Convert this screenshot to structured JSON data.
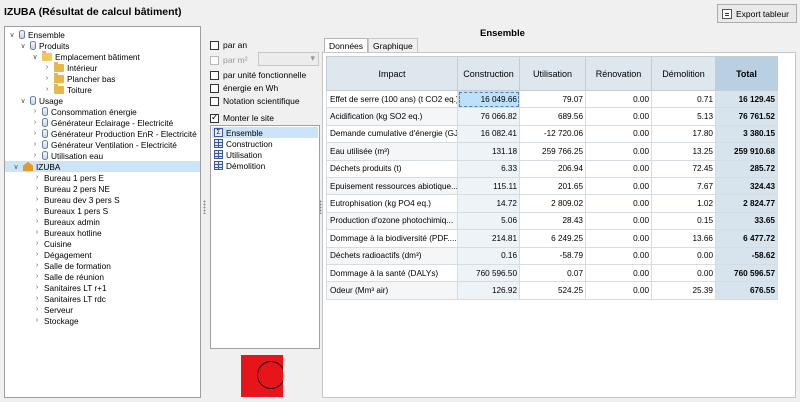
{
  "window": {
    "title": "IZUBA (Résultat de calcul bâtiment)",
    "export_label": "Export tableur"
  },
  "tree": {
    "items": [
      {
        "label": "Ensemble",
        "icon": "database-icon",
        "expander": "expanded"
      },
      {
        "label": "Produits",
        "icon": "database-icon",
        "expander": "expanded"
      },
      {
        "label": "Emplacement bâtiment",
        "icon": "folder-open-icon",
        "expander": "expanded"
      },
      {
        "label": "Intérieur",
        "icon": "folder-icon",
        "expander": "collapsed"
      },
      {
        "label": "Plancher bas",
        "icon": "folder-icon",
        "expander": "collapsed"
      },
      {
        "label": "Toiture",
        "icon": "folder-icon",
        "expander": "collapsed"
      },
      {
        "label": "Usage",
        "icon": "database-icon",
        "expander": "expanded"
      },
      {
        "label": "Consommation énergie",
        "icon": "database-icon",
        "expander": "collapsed"
      },
      {
        "label": "Générateur Eclairage - Electricité",
        "icon": "database-icon",
        "expander": "collapsed"
      },
      {
        "label": "Générateur Production EnR - Electricité",
        "icon": "database-icon",
        "expander": "collapsed"
      },
      {
        "label": "Générateur Ventilation - Electricité",
        "icon": "database-icon",
        "expander": "collapsed"
      },
      {
        "label": "Utilisation eau",
        "icon": "database-icon",
        "expander": "collapsed"
      },
      {
        "label": "IZUBA",
        "icon": "building-icon",
        "expander": "expanded"
      },
      {
        "label": "Bureau 1 pers E",
        "icon": "",
        "expander": "collapsed"
      },
      {
        "label": "Bureau 2 pers NE",
        "icon": "",
        "expander": "collapsed"
      },
      {
        "label": "Bureau dev 3 pers S",
        "icon": "",
        "expander": "collapsed"
      },
      {
        "label": "Bureaux 1 pers S",
        "icon": "",
        "expander": "collapsed"
      },
      {
        "label": "Bureaux admin",
        "icon": "",
        "expander": "collapsed"
      },
      {
        "label": "Bureaux hotline",
        "icon": "",
        "expander": "collapsed"
      },
      {
        "label": "Cuisine",
        "icon": "",
        "expander": "collapsed"
      },
      {
        "label": "Dégagement",
        "icon": "",
        "expander": "collapsed"
      },
      {
        "label": "Salle de formation",
        "icon": "",
        "expander": "collapsed"
      },
      {
        "label": "Salle de réunion",
        "icon": "",
        "expander": "collapsed"
      },
      {
        "label": "Sanitaires LT r+1",
        "icon": "",
        "expander": "collapsed"
      },
      {
        "label": "Sanitaires LT rdc",
        "icon": "",
        "expander": "collapsed"
      },
      {
        "label": "Serveur",
        "icon": "",
        "expander": "collapsed"
      },
      {
        "label": "Stockage",
        "icon": "",
        "expander": "collapsed"
      }
    ]
  },
  "options": {
    "par_an": "par an",
    "par_m2": "par m²",
    "par_unite": "par unité fonctionnelle",
    "energie_wh": "énergie en Wh",
    "notation": "Notation scientifique",
    "monter_site": "Monter le site"
  },
  "phases": {
    "items": [
      {
        "label": "Ensemble",
        "icon": "sigma-icon"
      },
      {
        "label": "Construction",
        "icon": "grid-icon"
      },
      {
        "label": "Utilisation",
        "icon": "grid-icon"
      },
      {
        "label": "Démolition",
        "icon": "grid-icon"
      }
    ]
  },
  "results": {
    "section_title": "Ensemble",
    "tabs": [
      "Données",
      "Graphique"
    ],
    "headers": [
      "Impact",
      "Construction",
      "Utilisation",
      "Rénovation",
      "Démolition",
      "Total"
    ],
    "rows": [
      {
        "impact": "Effet de serre (100 ans) (t CO2 eq.)",
        "construction": "16 049.66",
        "utilisation": "79.07",
        "renovation": "0.00",
        "demolition": "0.71",
        "total": "16 129.45"
      },
      {
        "impact": "Acidification (kg SO2 eq.)",
        "construction": "76 066.82",
        "utilisation": "689.56",
        "renovation": "0.00",
        "demolition": "5.13",
        "total": "76 761.52"
      },
      {
        "impact": "Demande cumulative d'énergie (GJ)",
        "construction": "16 082.41",
        "utilisation": "-12 720.06",
        "renovation": "0.00",
        "demolition": "17.80",
        "total": "3 380.15"
      },
      {
        "impact": "Eau utilisée (m³)",
        "construction": "131.18",
        "utilisation": "259 766.25",
        "renovation": "0.00",
        "demolition": "13.25",
        "total": "259 910.68"
      },
      {
        "impact": "Déchets produits (t)",
        "construction": "6.33",
        "utilisation": "206.94",
        "renovation": "0.00",
        "demolition": "72.45",
        "total": "285.72"
      },
      {
        "impact": "Epuisement ressources abiotique...",
        "construction": "115.11",
        "utilisation": "201.65",
        "renovation": "0.00",
        "demolition": "7.67",
        "total": "324.43"
      },
      {
        "impact": "Eutrophisation (kg PO4 eq.)",
        "construction": "14.72",
        "utilisation": "2 809.02",
        "renovation": "0.00",
        "demolition": "1.02",
        "total": "2 824.77"
      },
      {
        "impact": "Production d'ozone photochimiq...",
        "construction": "5.06",
        "utilisation": "28.43",
        "renovation": "0.00",
        "demolition": "0.15",
        "total": "33.65"
      },
      {
        "impact": "Dommage à la biodiversité (PDF....",
        "construction": "214.81",
        "utilisation": "6 249.25",
        "renovation": "0.00",
        "demolition": "13.66",
        "total": "6 477.72"
      },
      {
        "impact": "Déchets radioactifs (dm³)",
        "construction": "0.16",
        "utilisation": "-58.79",
        "renovation": "0.00",
        "demolition": "0.00",
        "total": "-58.62"
      },
      {
        "impact": "Dommage à la santé (DALYs)",
        "construction": "760 596.50",
        "utilisation": "0.07",
        "renovation": "0.00",
        "demolition": "0.00",
        "total": "760 596.57"
      },
      {
        "impact": "Odeur (Mm³ air)",
        "construction": "126.92",
        "utilisation": "524.25",
        "renovation": "0.00",
        "demolition": "25.39",
        "total": "676.55"
      }
    ]
  }
}
